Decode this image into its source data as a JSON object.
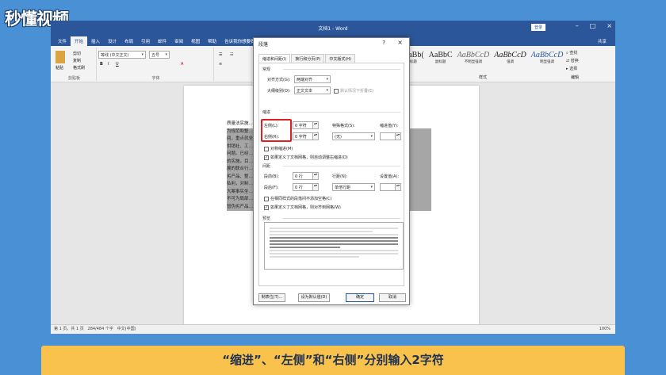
{
  "logo": {
    "text": "秒懂视频"
  },
  "window": {
    "title": "文档1 - Word",
    "login": "登录",
    "share": "共享"
  },
  "ribbon_tabs": [
    "文件",
    "开始",
    "插入",
    "设计",
    "布局",
    "引用",
    "邮件",
    "审阅",
    "视图",
    "帮助",
    "告诉我你想要做什么"
  ],
  "ribbon": {
    "clipboard": {
      "paste": "粘贴",
      "cut": "剪切",
      "copy": "复制",
      "format_painter": "格式刷",
      "label": "剪贴板"
    },
    "font": {
      "name": "等线 (中文正文)",
      "size": "五号",
      "label": "字体"
    },
    "styles": {
      "items": [
        {
          "preview": "AaBb(",
          "name": "标题"
        },
        {
          "preview": "AaBbC",
          "name": "副标题"
        },
        {
          "preview": "AaBbCcD",
          "name": "不明显强调"
        },
        {
          "preview": "AaBbCcD",
          "name": "强调"
        },
        {
          "preview": "AaBbCcD",
          "name": "明显强调"
        }
      ],
      "label": "样式"
    },
    "editing": {
      "find": "查找",
      "replace": "替换",
      "select": "选择",
      "label": "编辑"
    }
  },
  "document": {
    "lines": [
      "质量法实施…",
      "为规范和整…                                                              个月的时",
      "间，重点就全…                                                            开展资系",
      "供销社、工…                                                              保护主义",
      "问题。已经…",
      "的实施，目…                                                              面正在开",
      "展的联合行…                                                              击假冒伪",
      "劣产品、整…                                                              为谋一己",
      "私利，对制…                                                              问题，重",
      "大案事实坐…                                                              关领导切",
      "不可为局部…                                                              活动，让假",
      "冒伪劣产品…"
    ]
  },
  "statusbar": {
    "page": "第 1 页，共 1 页",
    "words": "284/484 个字",
    "lang": "中文(中国)",
    "zoom": "100%"
  },
  "dialog": {
    "title": "段落",
    "help": "?",
    "close": "×",
    "tabs": [
      "缩进和间距(I)",
      "换行和分页(P)",
      "中文版式(H)"
    ],
    "general": {
      "section": "常规",
      "alignment_label": "对齐方式(G):",
      "alignment_value": "两端对齐",
      "outline_label": "大纲级别(O):",
      "outline_value": "正文文本",
      "collapsed_label": "默认情况下折叠(E)"
    },
    "indent": {
      "section": "缩进",
      "left_label": "左侧(L):",
      "left_value": "0 字符",
      "right_label": "右侧(R):",
      "right_value": "0 字符",
      "special_label": "特殊格式(S):",
      "special_value": "(无)",
      "indent_by_label": "缩进值(Y):",
      "mirror_label": "对称缩进(M)",
      "grid_label": "如果定义了文档网格，则自动调整右缩进(D)"
    },
    "spacing": {
      "section": "间距",
      "before_label": "段前(B):",
      "before_value": "0 行",
      "after_label": "段后(F):",
      "after_value": "0 行",
      "line_label": "行距(N):",
      "line_value": "单倍行距",
      "at_label": "设置值(A):",
      "nospace_label": "在相同样式的段落间不添加空格(C)",
      "grid_label": "如果定义了文档网格，则对齐到网格(W)"
    },
    "preview": {
      "section": "预览"
    },
    "buttons": {
      "tabs": "制表位(T)...",
      "default": "设为默认值(D)",
      "ok": "确定",
      "cancel": "取消"
    }
  },
  "subtitle": "“缩进”、“左侧”和“右侧”分别输入2字符"
}
